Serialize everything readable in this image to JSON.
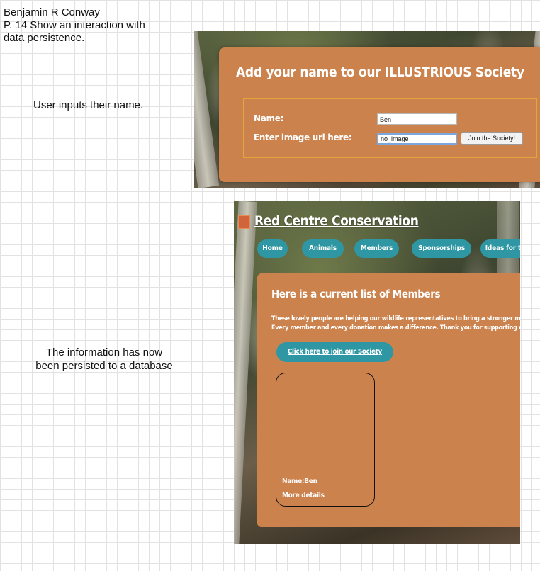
{
  "notes": {
    "author_lines": [
      "Benjamin R Conway",
      "P. 14 Show an interaction with",
      "data persistence."
    ],
    "input_caption": "User inputs their name.",
    "persist_caption": "The information has now been persisted to a database"
  },
  "form_screenshot": {
    "title": "Add your name to our ILLUSTRIOUS Society",
    "name_label": "Name:",
    "name_value": "Ben",
    "image_url_label": "Enter image url here:",
    "image_url_value": "no_image",
    "join_button": "Join the Society!",
    "colors": {
      "card": "#cc824c",
      "border": "#e3a63a"
    }
  },
  "members_screenshot": {
    "site_title": "Red Centre Conservation",
    "nav": [
      {
        "label": "Home"
      },
      {
        "label": "Animals"
      },
      {
        "label": "Members"
      },
      {
        "label": "Sponsorships"
      },
      {
        "label": "Ideas for th"
      }
    ],
    "heading": "Here is a current list of Members",
    "intro_lines": [
      "These lovely people are helping our wildlife representatives to bring a stronger m",
      "Every member and every donation makes a difference. Thank you for supporting o"
    ],
    "join_link": "Click here to join our Society",
    "member": {
      "name_text": "Name:Ben",
      "details_link": "More details"
    },
    "colors": {
      "card": "#cc824c",
      "nav": "#2e97a3"
    }
  }
}
